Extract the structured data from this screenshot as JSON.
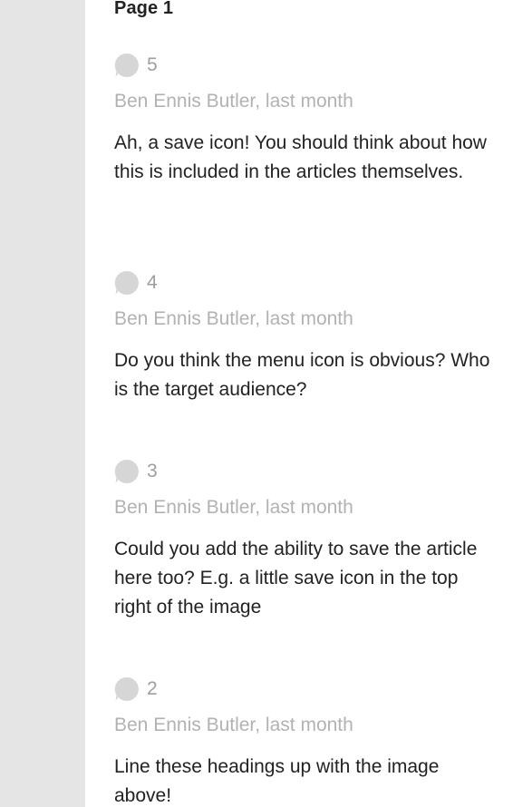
{
  "page": {
    "title": "Page 1"
  },
  "colors": {
    "gutter": "#e5e5e5",
    "bubble": "#d6d6d6",
    "meta_text": "#b2b2b2",
    "number_text": "#9e9e9e",
    "body_text": "#222222"
  },
  "comments": [
    {
      "number": "5",
      "meta": "Ben Ennis Butler, last month",
      "text": "Ah, a save icon! You should think about how this is included in the articles themselves.",
      "icon": "comment-bubble-icon"
    },
    {
      "number": "4",
      "meta": "Ben Ennis Butler, last month",
      "text": "Do you think the menu icon is obvious? Who is the target audience?",
      "icon": "comment-bubble-icon"
    },
    {
      "number": "3",
      "meta": "Ben Ennis Butler, last month",
      "text": "Could you add the ability to save the article here too? E.g. a little save icon in the top right of the image",
      "icon": "comment-bubble-icon"
    },
    {
      "number": "2",
      "meta": "Ben Ennis Butler, last month",
      "text": "Line these headings up with the image above!",
      "icon": "comment-bubble-icon"
    }
  ]
}
